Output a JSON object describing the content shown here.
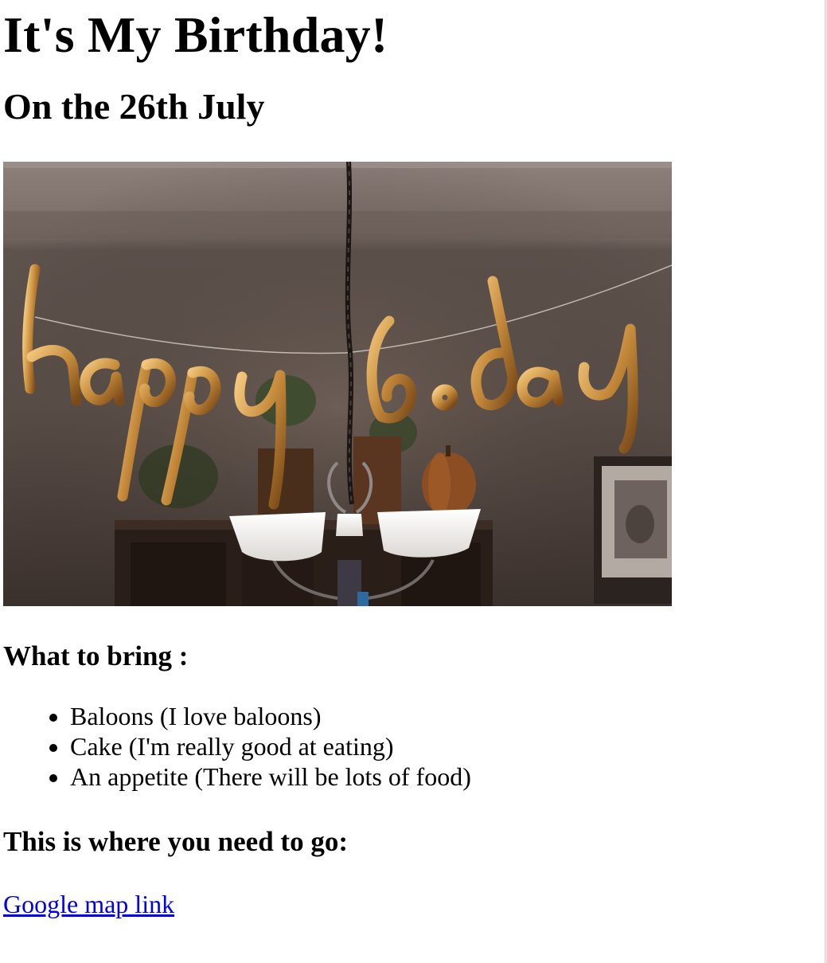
{
  "heading": {
    "title": "It's My Birthday!",
    "date_line": "On the 26th July"
  },
  "photo": {
    "description": "happy bday balloons",
    "colors": {
      "wall": "#5b4f49",
      "ceiling": "#8d807b",
      "balloon_gold": "#c58a3b",
      "shade_white": "#f4f2f0"
    }
  },
  "bring": {
    "heading": "What to bring :",
    "items": [
      "Baloons (I love baloons)",
      "Cake (I'm really good at eating)",
      "An appetite (There will be lots of food)"
    ]
  },
  "location": {
    "heading": "This is where you need to go:",
    "link_label": "Google map link",
    "link_color": "#0000ee"
  }
}
